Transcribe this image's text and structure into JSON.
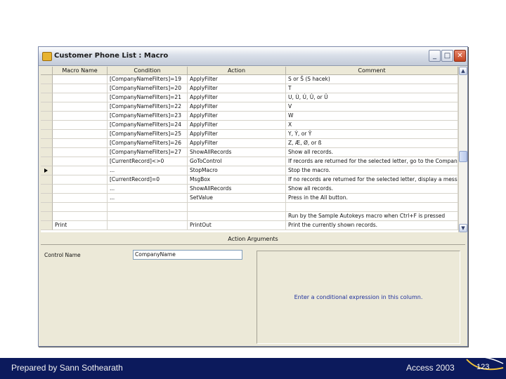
{
  "window": {
    "title": "Customer Phone List : Macro",
    "min_glyph": "_",
    "max_glyph": "□",
    "close_glyph": "✕"
  },
  "grid": {
    "headers": [
      "Macro Name",
      "Condition",
      "Action",
      "Comment"
    ],
    "current_row": 10,
    "rows": [
      {
        "name": "",
        "condition": "[CompanyNameFilters]=19",
        "action": "ApplyFilter",
        "comment": "S or Š (S hacek)"
      },
      {
        "name": "",
        "condition": "[CompanyNameFilters]=20",
        "action": "ApplyFilter",
        "comment": "T"
      },
      {
        "name": "",
        "condition": "[CompanyNameFilters]=21",
        "action": "ApplyFilter",
        "comment": "U, Ù, Ú, Û, or Ü"
      },
      {
        "name": "",
        "condition": "[CompanyNameFilters]=22",
        "action": "ApplyFilter",
        "comment": "V"
      },
      {
        "name": "",
        "condition": "[CompanyNameFilters]=23",
        "action": "ApplyFilter",
        "comment": "W"
      },
      {
        "name": "",
        "condition": "[CompanyNameFilters]=24",
        "action": "ApplyFilter",
        "comment": "X"
      },
      {
        "name": "",
        "condition": "[CompanyNameFilters]=25",
        "action": "ApplyFilter",
        "comment": "Y, Ý, or Ÿ"
      },
      {
        "name": "",
        "condition": "[CompanyNameFilters]=26",
        "action": "ApplyFilter",
        "comment": "Z, Æ, Ø, or ß"
      },
      {
        "name": "",
        "condition": "[CompanyNameFilters]=27",
        "action": "ShowAllRecords",
        "comment": "Show all records."
      },
      {
        "name": "",
        "condition": "[CurrentRecord]<>0",
        "action": "GoToControl",
        "comment": "If records are returned for the selected letter, go to the Company"
      },
      {
        "name": "",
        "condition": "...",
        "action": "StopMacro",
        "comment": "Stop the macro."
      },
      {
        "name": "",
        "condition": "[CurrentRecord]=0",
        "action": "MsgBox",
        "comment": "If no records are returned for the selected letter, display a message"
      },
      {
        "name": "",
        "condition": "...",
        "action": "ShowAllRecords",
        "comment": "Show all records."
      },
      {
        "name": "",
        "condition": "...",
        "action": "SetValue",
        "comment": "Press in the All button."
      },
      {
        "name": "",
        "condition": "",
        "action": "",
        "comment": ""
      },
      {
        "name": "",
        "condition": "",
        "action": "",
        "comment": "Run by the Sample Autokeys macro when Ctrl+F is pressed"
      },
      {
        "name": "Print",
        "condition": "",
        "action": "PrintOut",
        "comment": "Print the currently shown records."
      }
    ]
  },
  "action_arguments": {
    "title": "Action Arguments",
    "control_name_label": "Control Name",
    "control_name_value": "CompanyName",
    "help_text": "Enter a conditional expression in this column."
  },
  "scrollbar": {
    "up_glyph": "▲",
    "down_glyph": "▼"
  },
  "footer": {
    "left": "Prepared by Sann Sothearath",
    "right": "Access 2003",
    "page": "123"
  }
}
